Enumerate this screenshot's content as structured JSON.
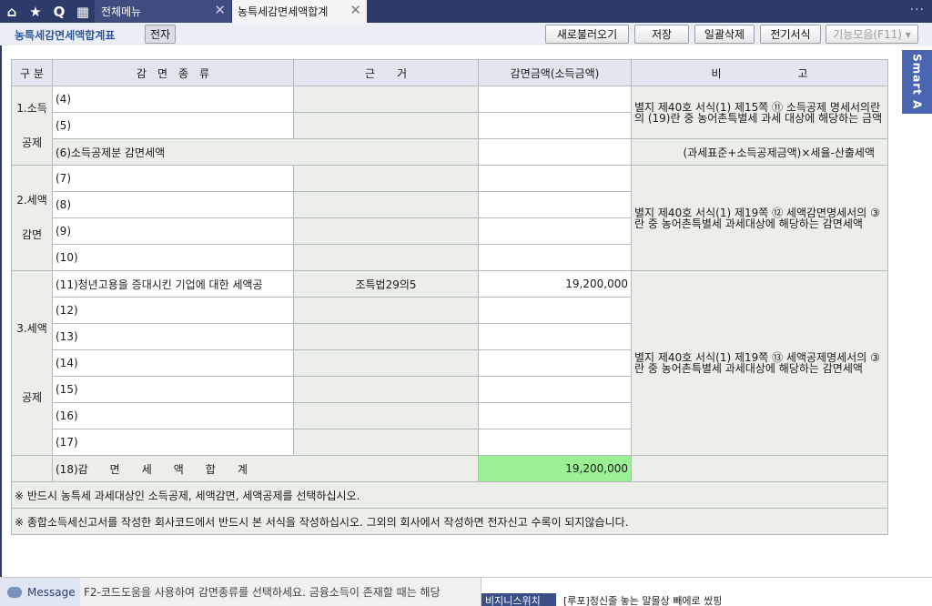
{
  "tabbar": {
    "tabs": [
      {
        "label": "전체메뉴"
      },
      {
        "label": "농특세감면세액합계"
      }
    ],
    "more": "···"
  },
  "header": {
    "title": "농특세감면세액합계표",
    "badge": "전자",
    "buttons": {
      "reload": "새로불러오기",
      "save": "저장",
      "delete_all": "일괄삭제",
      "e_form": "전기서식",
      "functions": "기능모음(F11) ▾"
    }
  },
  "smart_tab": "Smart A",
  "table": {
    "headers": {
      "category": "구 분",
      "type": "감　면　종　류",
      "basis": "근　　거",
      "amount": "감면금액(소득금액)",
      "remarks": "비　　　　　　　고"
    },
    "sections": {
      "income": "1.소득\n\n공제",
      "tax_reduction": "2.세액\n\n감면",
      "tax_credit": "3.세액\n\n\n\n공제"
    },
    "rows": {
      "r4": "(4)",
      "r5": "(5)",
      "r6": "(6)소득공제분 감면세액",
      "r7": "(7)",
      "r8": "(8)",
      "r9": "(9)",
      "r10": "(10)",
      "r11": "(11)청년고용을 증대시킨 기업에 대한 세액공",
      "r12": "(12)",
      "r13": "(13)",
      "r14": "(14)",
      "r15": "(15)",
      "r16": "(16)",
      "r17": "(17)",
      "r18": "(18)감　　면　　세　　액　　합　　계"
    },
    "r11_basis": "조특법29의5",
    "r11_amount": "19,200,000",
    "total_amount": "19,200,000",
    "r6_formula": "(과세표준+소득공제금액)×세율-산출세액",
    "notes": {
      "income": "별지 제40호 서식(1) 제15쪽 ⑪ 소득공제\n명세서의란의 (19)란 중 농어촌특별세\n과세 대상에 해당하는 금액",
      "reduction": "별지 제40호 서식(1) 제19쪽\n⑫ 세액감면명세서의 ③란 중\n농어촌특별세 과세대상에\n해당하는 감면세액",
      "credit": "별지 제40호 서식(1) 제19쪽\n⑬ 세액공제명세서의 ③란 중\n농어촌특별세 과세대상에\n해당하는 감면세액"
    },
    "footer_notes": [
      "※ 반드시 농특세 과세대상인 소득공제, 세액감면, 세액공제를 선택하십시오.",
      "※ 종합소득세신고서를 작성한 회사코드에서 반드시 본 서식을 작성하십시오. 그외의 회사에서 작성하면 전자신고 수록이 되지않습니다."
    ]
  },
  "statusbar": {
    "message_label": "Message",
    "message_text": "F2-코드도움을 사용하여 감면종류를 선택하세요. 금융소득이 존재할 때는 해당",
    "side_label": "비지니스위치",
    "side_text": "[루포]정신줄 놓는 말몰상 빼에로 쌌핑"
  }
}
